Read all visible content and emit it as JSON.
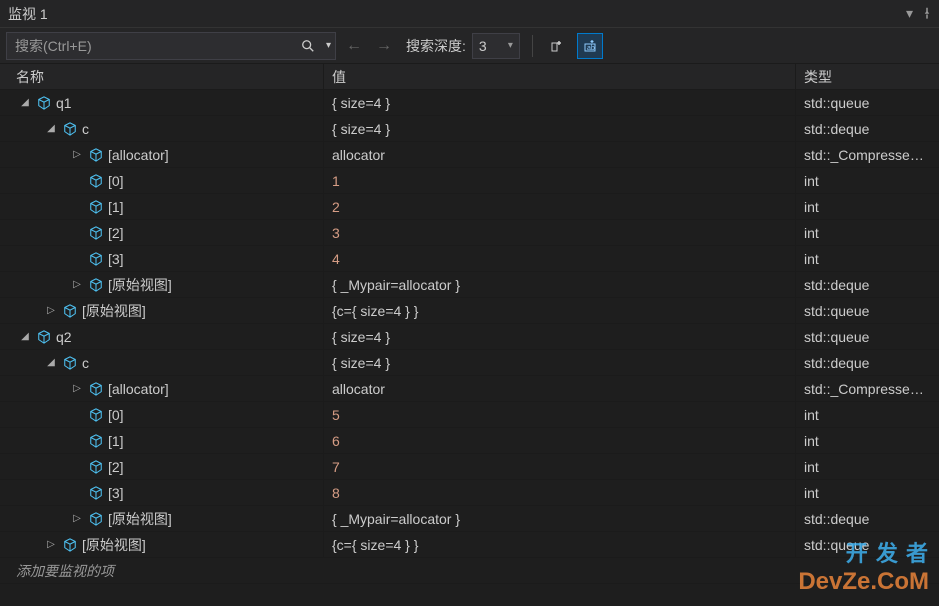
{
  "title": "监视 1",
  "search": {
    "placeholder": "搜索(Ctrl+E)"
  },
  "toolbar": {
    "depth_label": "搜索深度:",
    "depth_value": "3"
  },
  "columns": {
    "name": "名称",
    "value": "值",
    "type": "类型"
  },
  "add_item_text": "添加要监视的项",
  "watermark": {
    "line1": "开 发 者",
    "line2": "DevZe.CoM"
  },
  "rows": [
    {
      "depth": 0,
      "exp": "open",
      "name": "q1",
      "value": "{ size=4 }",
      "type": "std::queue<int,st…",
      "vclass": ""
    },
    {
      "depth": 1,
      "exp": "open",
      "name": "c",
      "value": "{ size=4 }",
      "type": "std::deque<int,st…",
      "vclass": ""
    },
    {
      "depth": 2,
      "exp": "closed",
      "name": "[allocator]",
      "value": "allocator",
      "type": "std::_Compresse…",
      "vclass": ""
    },
    {
      "depth": 2,
      "exp": "none",
      "name": "[0]",
      "value": "1",
      "type": "int",
      "vclass": "val-red"
    },
    {
      "depth": 2,
      "exp": "none",
      "name": "[1]",
      "value": "2",
      "type": "int",
      "vclass": "val-red"
    },
    {
      "depth": 2,
      "exp": "none",
      "name": "[2]",
      "value": "3",
      "type": "int",
      "vclass": "val-red"
    },
    {
      "depth": 2,
      "exp": "none",
      "name": "[3]",
      "value": "4",
      "type": "int",
      "vclass": "val-red"
    },
    {
      "depth": 2,
      "exp": "closed",
      "name": "[原始视图]",
      "value": "{ _Mypair=allocator }",
      "type": "std::deque<int,st…",
      "vclass": ""
    },
    {
      "depth": 1,
      "exp": "closed",
      "name": "[原始视图]",
      "value": "{c={ size=4 } }",
      "type": "std::queue<int,st…",
      "vclass": ""
    },
    {
      "depth": 0,
      "exp": "open",
      "name": "q2",
      "value": "{ size=4 }",
      "type": "std::queue<int,st…",
      "vclass": ""
    },
    {
      "depth": 1,
      "exp": "open",
      "name": "c",
      "value": "{ size=4 }",
      "type": "std::deque<int,st…",
      "vclass": ""
    },
    {
      "depth": 2,
      "exp": "closed",
      "name": "[allocator]",
      "value": "allocator",
      "type": "std::_Compresse…",
      "vclass": ""
    },
    {
      "depth": 2,
      "exp": "none",
      "name": "[0]",
      "value": "5",
      "type": "int",
      "vclass": "val-red"
    },
    {
      "depth": 2,
      "exp": "none",
      "name": "[1]",
      "value": "6",
      "type": "int",
      "vclass": "val-red"
    },
    {
      "depth": 2,
      "exp": "none",
      "name": "[2]",
      "value": "7",
      "type": "int",
      "vclass": "val-red"
    },
    {
      "depth": 2,
      "exp": "none",
      "name": "[3]",
      "value": "8",
      "type": "int",
      "vclass": "val-red"
    },
    {
      "depth": 2,
      "exp": "closed",
      "name": "[原始视图]",
      "value": "{ _Mypair=allocator }",
      "type": "std::deque<int,st…",
      "vclass": ""
    },
    {
      "depth": 1,
      "exp": "closed",
      "name": "[原始视图]",
      "value": "{c={ size=4 } }",
      "type": "std::queue<int,st…",
      "vclass": ""
    }
  ]
}
